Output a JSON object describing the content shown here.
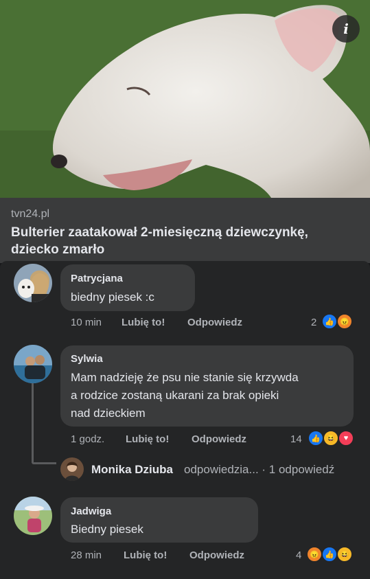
{
  "post": {
    "domain": "tvn24.pl",
    "headline": "Bulterier zaatakował 2-miesięczną dziewczynkę, dziecko zmarło",
    "info_icon_glyph": "i"
  },
  "comments": [
    {
      "author": "Patrycjana",
      "text": "biedny piesek :c",
      "time": "10 min",
      "like_label": "Lubię to!",
      "reply_label": "Odpowiedz",
      "reaction_count": "2",
      "reactions": [
        "like-icon",
        "angry-icon"
      ]
    },
    {
      "author": "Sylwia",
      "text_lines": [
        "Mam nadzieję że psu nie stanie się krzywda",
        "a rodzice zostaną ukarani za brak opieki",
        "nad dzieckiem"
      ],
      "time": "1 godz.",
      "like_label": "Lubię to!",
      "reply_label": "Odpowiedz",
      "reaction_count": "14",
      "reactions": [
        "like-icon",
        "haha-icon",
        "love-icon"
      ],
      "reply_preview": {
        "name": "Monika Dziuba",
        "rest": "odpowiedzia... · 1 odpowiedź"
      }
    },
    {
      "author": "Jadwiga",
      "text": "Biedny piesek",
      "time": "28 min",
      "like_label": "Lubię to!",
      "reply_label": "Odpowiedz",
      "reaction_count": "4",
      "reactions": [
        "angry-icon",
        "like-icon",
        "haha-icon"
      ]
    }
  ],
  "colors": {
    "background": "#18191b",
    "comment_panel": "#242526",
    "bubble": "#3a3b3c",
    "like": "#1877f2",
    "angry": "#f0842b",
    "haha": "#f7b928",
    "love": "#f33e58"
  }
}
